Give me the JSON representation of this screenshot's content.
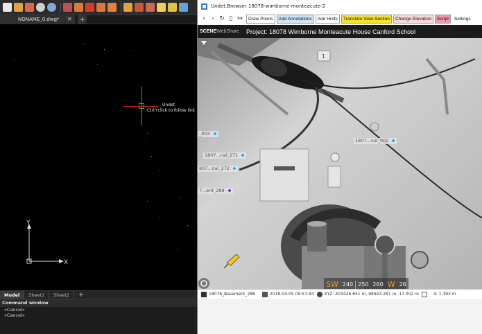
{
  "cad": {
    "doc_tab": "NONAME_0.dwg*",
    "doc_tab_close": "×",
    "new_tab": "+",
    "hover_title": "Undet",
    "hover_hint": "Ctrl+click to follow link",
    "ucs_x": "X",
    "ucs_y": "Y",
    "sheet_tabs": [
      "Model",
      "Sheet1",
      "Sheet2"
    ],
    "sheet_add": "+",
    "command_window_title": "Command window",
    "command_lines": [
      "«Cancel»",
      "«Cancel»"
    ],
    "toolbar_icons": [
      "new-file-icon",
      "open-icon",
      "save-icon",
      "undo-icon",
      "redo-icon",
      "arc-icon",
      "cloud-icon",
      "cloud-red-icon",
      "layers-icon",
      "properties-icon",
      "paint-icon",
      "mesh-icon",
      "blocks-icon",
      "measure-icon",
      "triangle-icon",
      "chart-icon"
    ]
  },
  "browser": {
    "window_title": "Undet.Browser 18078-wimborne-monteacute-2",
    "nav_icons": [
      "back-icon",
      "forward-icon",
      "refresh-icon",
      "page-icon",
      "exit-icon"
    ],
    "buttons": [
      {
        "label": "Draw Points",
        "bg": "#ffffff"
      },
      {
        "label": "Add Annotations",
        "bg": "#cde3f8"
      },
      {
        "label": "Add Hrefs",
        "bg": "#ffffff"
      },
      {
        "label": "Translate View Section",
        "bg": "#f6e22e"
      },
      {
        "label": "Change Elevation",
        "bg": "#f9d7dd"
      },
      {
        "label": "Script",
        "bg": "#f29aa9"
      }
    ],
    "settings_label": "Settings",
    "logo_scene": "SCENE",
    "logo_web": "WebShare",
    "project_title": "Project: 18078 Wimborne Monteacute House Canford School",
    "scan_tags": [
      {
        "label": "_003",
        "color": "#2aa7e6"
      },
      {
        "label": "1807...nal_271",
        "color": "#2aa7e6"
      },
      {
        "label": "807...nal_272",
        "color": "#2aa7e6"
      },
      {
        "label": "7...ent_288",
        "color": "#7a38c8"
      },
      {
        "label": "1807...nal_002",
        "color": "#2aa7e6"
      }
    ],
    "bubble_number": "1",
    "compass": [
      "SW",
      "240",
      "250",
      "260",
      "W",
      "26"
    ],
    "status": {
      "scan_name": "18078_Basement_288",
      "datetime": "2018-04-05 09:57:44",
      "coords": "XYZ: 403426.651 m, 98943.261 m, 17.002 m",
      "distance": "d: 1.393 m"
    }
  }
}
